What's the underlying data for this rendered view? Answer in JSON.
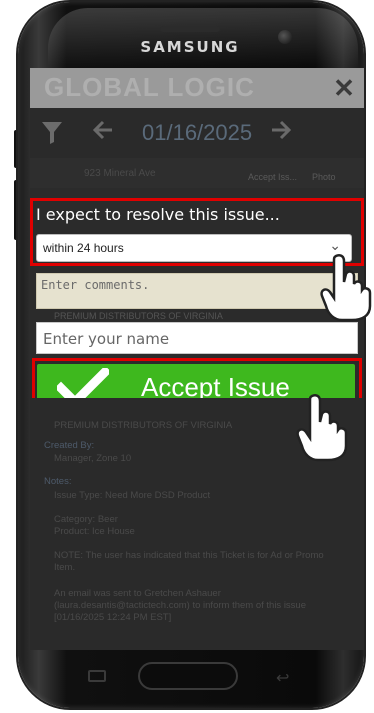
{
  "device": {
    "brand": "SAMSUNG"
  },
  "app": {
    "logo_text": "GLOBAL LOGIC",
    "close_icon": "close-icon",
    "nav": {
      "date": "01/16/2025",
      "filter_icon": "filter-icon",
      "prev_icon": "arrow-left-icon",
      "next_icon": "arrow-right-icon"
    },
    "toolbar": {
      "accept_label": "Accept Iss...",
      "photo_label": "Photo"
    },
    "ticket": {
      "address": "923 Mineral Ave",
      "distributor_mid": "PREMIUM DISTRIBUTORS OF VIRGINIA",
      "distributor": "PREMIUM DISTRIBUTORS OF VIRGINIA",
      "created_by_label": "Created By:",
      "created_by": "Manager, Zone 10",
      "notes_label": "Notes:",
      "issue_type": "Issue Type: Need More DSD Product",
      "category": "Category: Beer",
      "product": "Product: Ice House",
      "note_ad": "NOTE: The user has indicated that this Ticket is for Ad or Promo Item.",
      "email_note": "An email was sent to Gretchen Ashauer (laura.desantis@tactictech.com) to inform them of this issue [01/16/2025 12:24 PM EST]"
    }
  },
  "modal": {
    "prompt": "I expect to resolve this issue...",
    "resolve_select": {
      "value": "within 24 hours",
      "caret_icon": "chevron-down-icon"
    },
    "comments_placeholder": "Enter comments.",
    "name_placeholder": "Enter your name",
    "accept_button": {
      "label": "Accept Issue",
      "icon": "checkmark-icon"
    }
  },
  "colors": {
    "highlight": "#e00000",
    "accept_green": "#3eb81e",
    "comments_bg": "#e6e2cf"
  }
}
